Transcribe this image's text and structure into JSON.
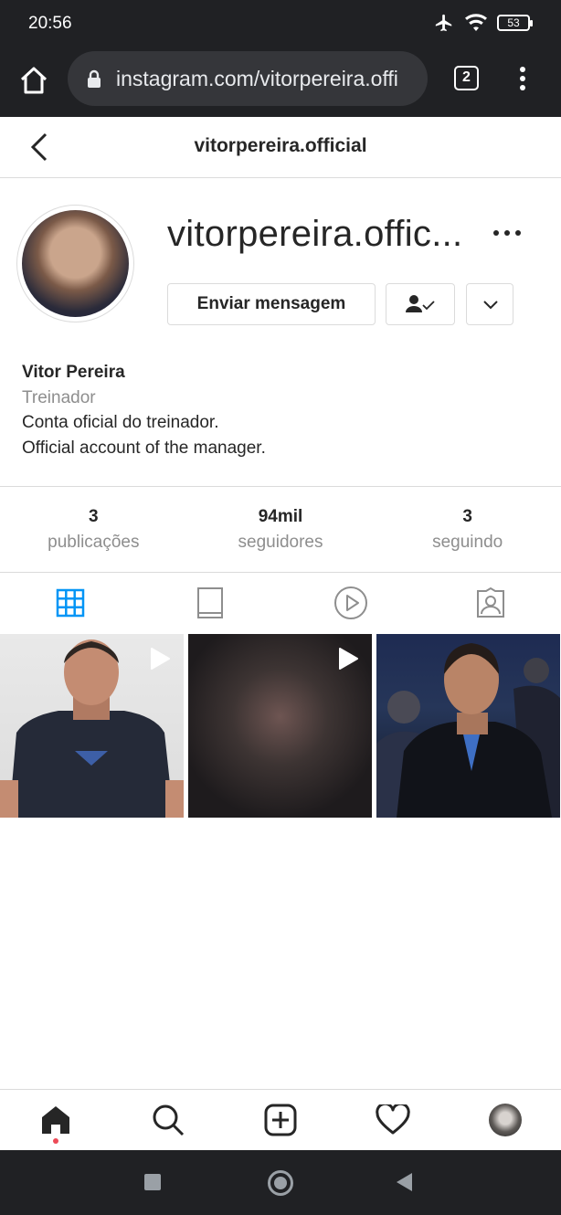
{
  "status_bar": {
    "time": "20:56",
    "battery": "53"
  },
  "browser": {
    "url": "instagram.com/vitorpereira.offi",
    "tab_count": "2"
  },
  "header": {
    "title": "vitorpereira.official"
  },
  "profile": {
    "username": "vitorpereira.offic...",
    "message_button": "Enviar mensagem",
    "name": "Vitor Pereira",
    "category": "Treinador",
    "bio_lines": [
      "Conta oficial do treinador.",
      "Official account of the manager."
    ]
  },
  "stats": [
    {
      "value": "3",
      "label": "publicações"
    },
    {
      "value": "94mil",
      "label": "seguidores"
    },
    {
      "value": "3",
      "label": "seguindo"
    }
  ],
  "tabs": [
    "grid-icon",
    "feed-icon",
    "reels-icon",
    "tagged-icon"
  ],
  "active_tab": "grid-icon",
  "posts": [
    {
      "type": "video",
      "icon": "play-icon"
    },
    {
      "type": "video",
      "icon": "play-icon"
    },
    {
      "type": "photo"
    }
  ],
  "bottom_nav": [
    "home-icon",
    "search-icon",
    "new-post-icon",
    "activity-icon",
    "profile-avatar"
  ],
  "colors": {
    "accent": "#0095f6",
    "text": "#262626",
    "muted": "#8e8e8e",
    "border": "#dbdbdb",
    "chrome": "#202124",
    "notification": "#ed4956"
  }
}
